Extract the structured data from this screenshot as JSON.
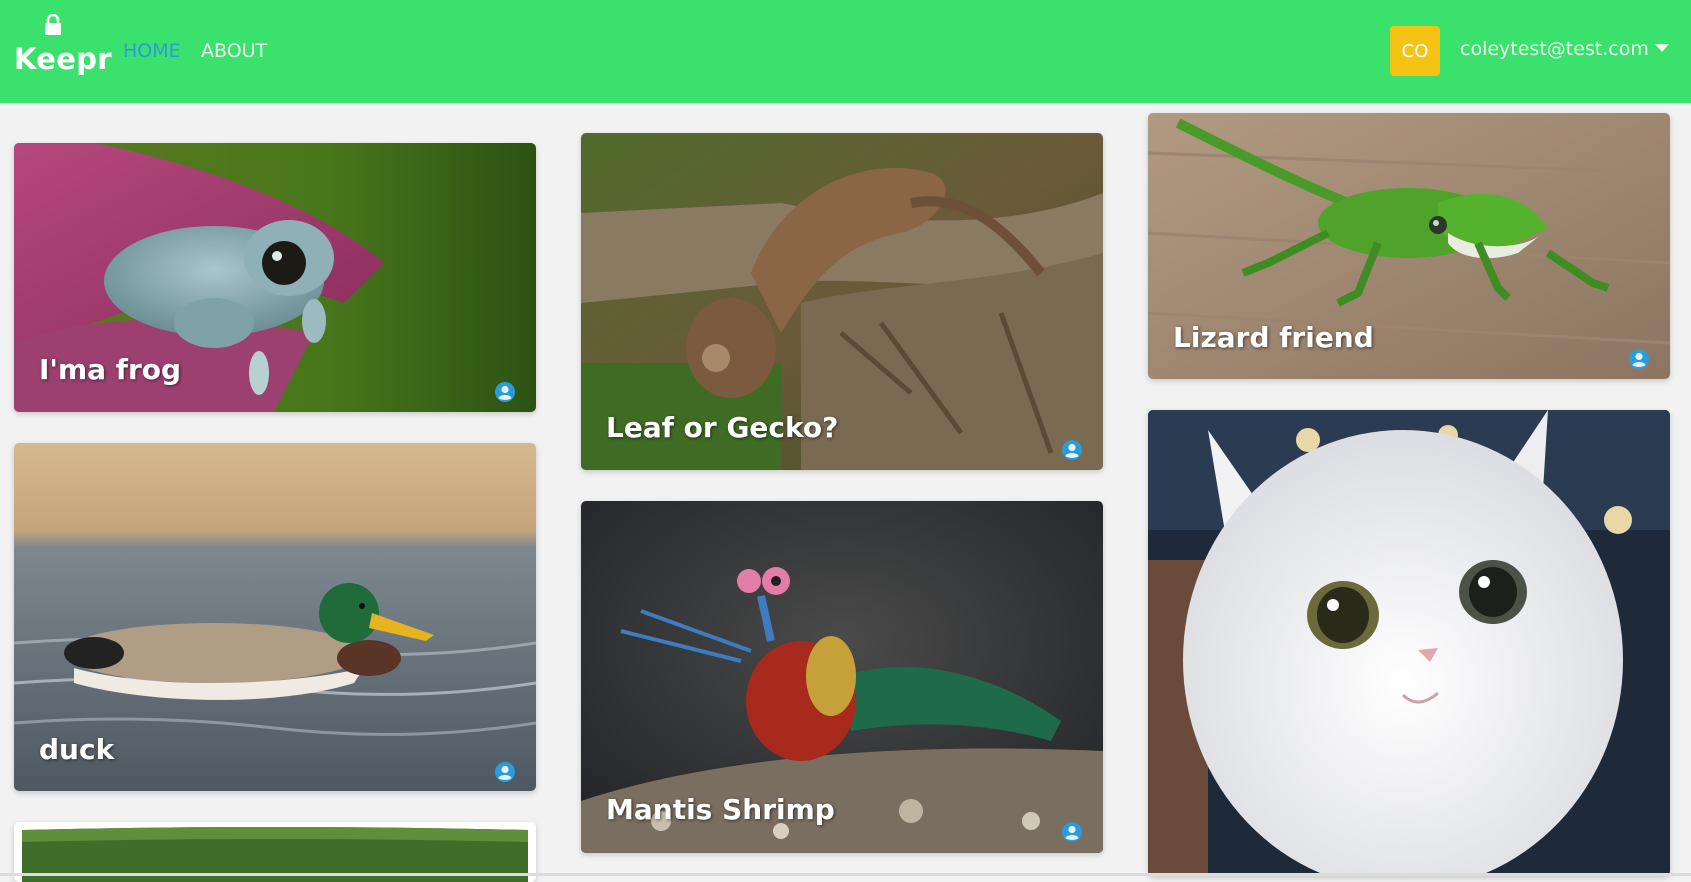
{
  "brand": {
    "name": "Keepr",
    "icon": "lock-icon"
  },
  "nav": {
    "home_label": "HOME",
    "about_label": "ABOUT",
    "active": "home"
  },
  "user": {
    "initials": "CO",
    "email": "coleytest@test.com",
    "badge_color": "#f4c313"
  },
  "colors": {
    "navbar": "#3be16d",
    "active_link": "#2b9cdb",
    "background": "#f2f2f2"
  },
  "keeps": [
    {
      "title": "I'ma frog",
      "subject": "frog",
      "icon": "user-circle-icon"
    },
    {
      "title": "duck",
      "subject": "duck",
      "icon": "user-circle-icon"
    },
    {
      "title": "",
      "subject": "partial-card",
      "icon": ""
    },
    {
      "title": "Leaf or Gecko?",
      "subject": "gecko",
      "icon": "user-circle-icon"
    },
    {
      "title": "Mantis Shrimp",
      "subject": "mantis-shrimp",
      "icon": "user-circle-icon"
    },
    {
      "title": "Lizard friend",
      "subject": "lizard",
      "icon": "user-circle-icon"
    },
    {
      "title": "",
      "subject": "cat",
      "icon": ""
    }
  ]
}
